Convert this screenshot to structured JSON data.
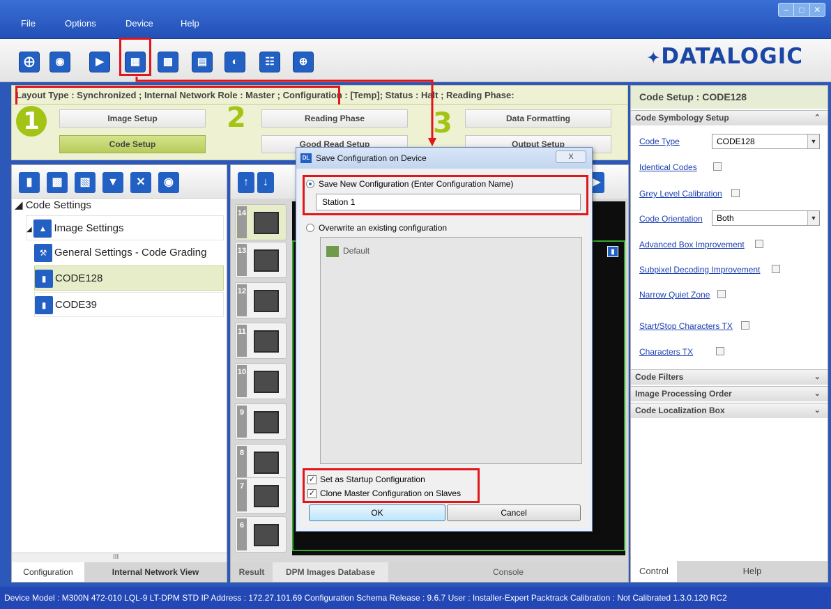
{
  "menu": {
    "items": [
      "File",
      "Options",
      "Device",
      "Help"
    ]
  },
  "window_controls": [
    "minimize-icon",
    "maximize-icon",
    "close-icon"
  ],
  "toolbar": {
    "icons": [
      "home-icon",
      "capture-icon",
      "send-config-icon",
      "save-config-icon",
      "load-config-icon",
      "save-file-icon",
      "save-to-device-icon",
      "grid-icon",
      "crosshair-icon"
    ],
    "brand": "DATALOGIC"
  },
  "status_line": "Layout Type : Synchronized ; Internal Network Role : Master ; Configuration : [Temp]; Status : Halt ; Reading Phase:",
  "phases": {
    "p1": {
      "num": "1",
      "buttons": [
        "Image Setup",
        "Code Setup"
      ]
    },
    "p2": {
      "num": "2",
      "buttons": [
        "Reading Phase",
        "Good Read Setup"
      ]
    },
    "p3": {
      "num": "3",
      "buttons": [
        "Data Formatting",
        "Output Setup"
      ]
    }
  },
  "right_panel": {
    "title": "Code Setup : CODE128",
    "section_main": "Code Symbology Setup",
    "code_type_label": "Code Type",
    "code_type_value": "CODE128",
    "identical_codes": "Identical Codes",
    "grey_level": "Grey Level Calibration",
    "orientation_label": "Code Orientation",
    "orientation_value": "Both",
    "advanced_box": "Advanced Box Improvement",
    "subpixel": "Subpixel Decoding Improvement",
    "narrow_quiet": "Narrow Quiet Zone",
    "start_stop": "Start/Stop Characters TX",
    "characters_tx": "Characters TX",
    "sections": [
      "Code Filters",
      "Image Processing Order",
      "Code Localization Box"
    ],
    "tabs": [
      "Control",
      "Help"
    ]
  },
  "left_panel": {
    "root": "Code Settings",
    "items": [
      "Image Settings",
      "General Settings - Code Grading",
      "CODE128",
      "CODE39"
    ],
    "scroll_mark": "III",
    "tabs": [
      "Configuration",
      "Internal Network View"
    ]
  },
  "center_panel": {
    "thumb_numbers": [
      "14",
      "13",
      "12",
      "11",
      "10",
      "9",
      "8",
      "7",
      "6"
    ],
    "tabs": [
      "Result",
      "DPM Images Database",
      "Console"
    ]
  },
  "dialog": {
    "title": "Save Configuration on Device",
    "close_label": "X",
    "opt_new": "Save New Configuration (Enter Configuration Name)",
    "name_value": "Station 1",
    "opt_overwrite": "Overwrite an existing configuration",
    "list_item": "Default",
    "startup": "Set as Startup Configuration",
    "clone": "Clone Master Configuration on Slaves",
    "ok": "OK",
    "cancel": "Cancel"
  },
  "bottom_bar": "Device Model : M300N 472-010 LQL-9 LT-DPM STD   IP Address : 172.27.101.69   Configuration Schema Release : 9.6.7   User : Installer-Expert   Packtrack Calibration : Not Calibrated 1.3.0.120 RC2",
  "colors": {
    "accent_blue": "#2360c4",
    "phase_green": "#a3c414",
    "highlight_red": "#e1151a",
    "panel_bg": "#eef1d2"
  }
}
